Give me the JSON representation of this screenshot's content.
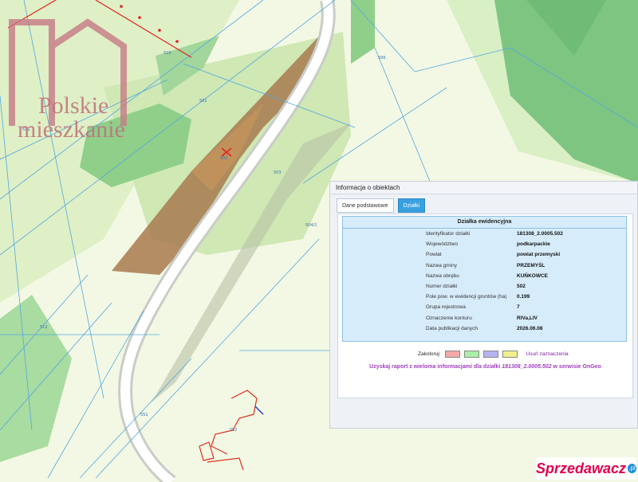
{
  "map": {
    "parcel_labels": [
      "502",
      "501",
      "503",
      "504/1",
      "506",
      "510",
      "511",
      "512",
      "551",
      "552",
      "555",
      "5001",
      "98/1",
      "96",
      "6017",
      "95"
    ]
  },
  "watermark": {
    "line1": "Polskie",
    "line2": "mieszkanie"
  },
  "branding": {
    "text": "Sprzedawacz",
    "badge": ".pl"
  },
  "panel": {
    "title": "Informacja o obiektach",
    "tabs": [
      "Dane podstawowe",
      "Działki"
    ],
    "active_tab": 1,
    "section_title": "Działka ewidencyjna",
    "rows": [
      {
        "label": "Identyfikator działki",
        "value": "181308_2.0005.502"
      },
      {
        "label": "Województwo",
        "value": "podkarpackie"
      },
      {
        "label": "Powiat",
        "value": "powiat przemyski"
      },
      {
        "label": "Nazwa gminy",
        "value": "PRZEMYŚL"
      },
      {
        "label": "Nazwa obrębu",
        "value": "KUŃKOWCE"
      },
      {
        "label": "Numer działki",
        "value": "502"
      },
      {
        "label": "Pole pow. w ewidencji gruntów (ha)",
        "value": "0.199"
      },
      {
        "label": "Grupa rejestrowa",
        "value": "7"
      },
      {
        "label": "Oznaczenie konturu",
        "value": "RIVa,LIV"
      },
      {
        "label": "Data publikacji danych",
        "value": "2026.06.08"
      }
    ],
    "legend": {
      "label": "Zakoloruj:",
      "colors": [
        "#f4a9a9",
        "#a8efa8",
        "#b7b3f0",
        "#f2f08f"
      ],
      "clear_label": "Usuń zaznaczenia"
    },
    "report": {
      "prefix": "Uzyskaj raport z wieloma informacjami dla działki",
      "parcel": "181308_2.0005.502",
      "suffix": "w serwisie OnGeo"
    }
  }
}
